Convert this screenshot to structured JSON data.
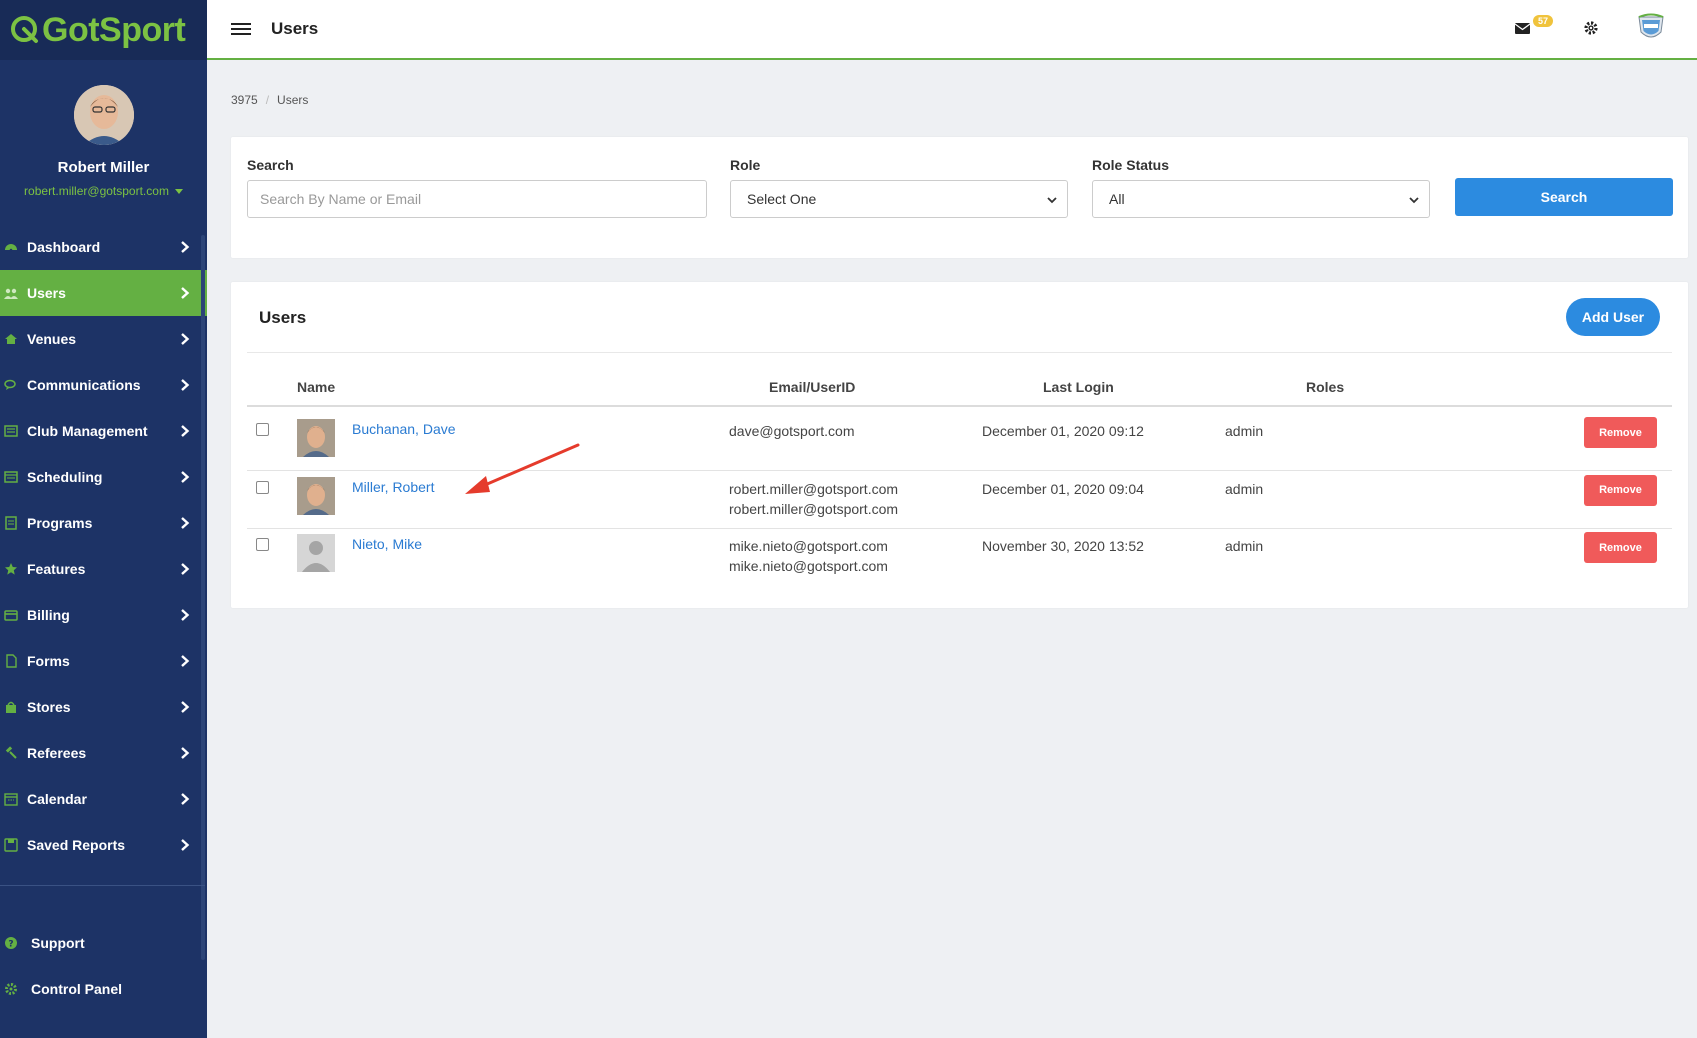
{
  "brand": {
    "logo_text": "GotSport",
    "accent": "#64b043",
    "sidebar_bg": "#1d3366",
    "primary": "#2c8be0",
    "danger": "#f05a5a"
  },
  "profile": {
    "name": "Robert Miller",
    "email": "robert.miller@gotsport.com"
  },
  "sidebar": {
    "items": [
      {
        "label": "Dashboard",
        "icon": "dashboard-icon",
        "active": false
      },
      {
        "label": "Users",
        "icon": "users-icon",
        "active": true
      },
      {
        "label": "Venues",
        "icon": "venues-icon",
        "active": false
      },
      {
        "label": "Communications",
        "icon": "communications-icon",
        "active": false
      },
      {
        "label": "Club Management",
        "icon": "club-management-icon",
        "active": false
      },
      {
        "label": "Scheduling",
        "icon": "scheduling-icon",
        "active": false
      },
      {
        "label": "Programs",
        "icon": "programs-icon",
        "active": false
      },
      {
        "label": "Features",
        "icon": "star-icon",
        "active": false
      },
      {
        "label": "Billing",
        "icon": "billing-icon",
        "active": false
      },
      {
        "label": "Forms",
        "icon": "forms-icon",
        "active": false
      },
      {
        "label": "Stores",
        "icon": "stores-icon",
        "active": false
      },
      {
        "label": "Referees",
        "icon": "gavel-icon",
        "active": false
      },
      {
        "label": "Calendar",
        "icon": "calendar-icon",
        "active": false
      },
      {
        "label": "Saved Reports",
        "icon": "save-icon",
        "active": false
      }
    ],
    "support": [
      {
        "label": "Support",
        "icon": "question-icon"
      },
      {
        "label": "Control Panel",
        "icon": "gear-icon"
      }
    ]
  },
  "topbar": {
    "title": "Users",
    "mail_count": "57"
  },
  "breadcrumb": {
    "root": "3975",
    "current": "Users"
  },
  "filters": {
    "search_label": "Search",
    "search_placeholder": "Search By Name or Email",
    "role_label": "Role",
    "role_value": "Select One",
    "status_label": "Role Status",
    "status_value": "All",
    "search_button": "Search"
  },
  "users_card": {
    "title": "Users",
    "add_button": "Add User",
    "columns": [
      "Name",
      "Email/UserID",
      "Last Login",
      "Roles"
    ],
    "rows": [
      {
        "name": "Buchanan, Dave",
        "email": "dave@gotsport.com",
        "userid": "",
        "last_login": "December 01, 2020 09:12",
        "role": "admin",
        "remove": "Remove",
        "avatar": "photo"
      },
      {
        "name": "Miller, Robert",
        "email": "robert.miller@gotsport.com",
        "userid": "robert.miller@gotsport.com",
        "last_login": "December 01, 2020 09:04",
        "role": "admin",
        "remove": "Remove",
        "avatar": "photo"
      },
      {
        "name": "Nieto, Mike",
        "email": "mike.nieto@gotsport.com",
        "userid": "mike.nieto@gotsport.com",
        "last_login": "November 30, 2020 13:52",
        "role": "admin",
        "remove": "Remove",
        "avatar": "placeholder"
      }
    ]
  }
}
